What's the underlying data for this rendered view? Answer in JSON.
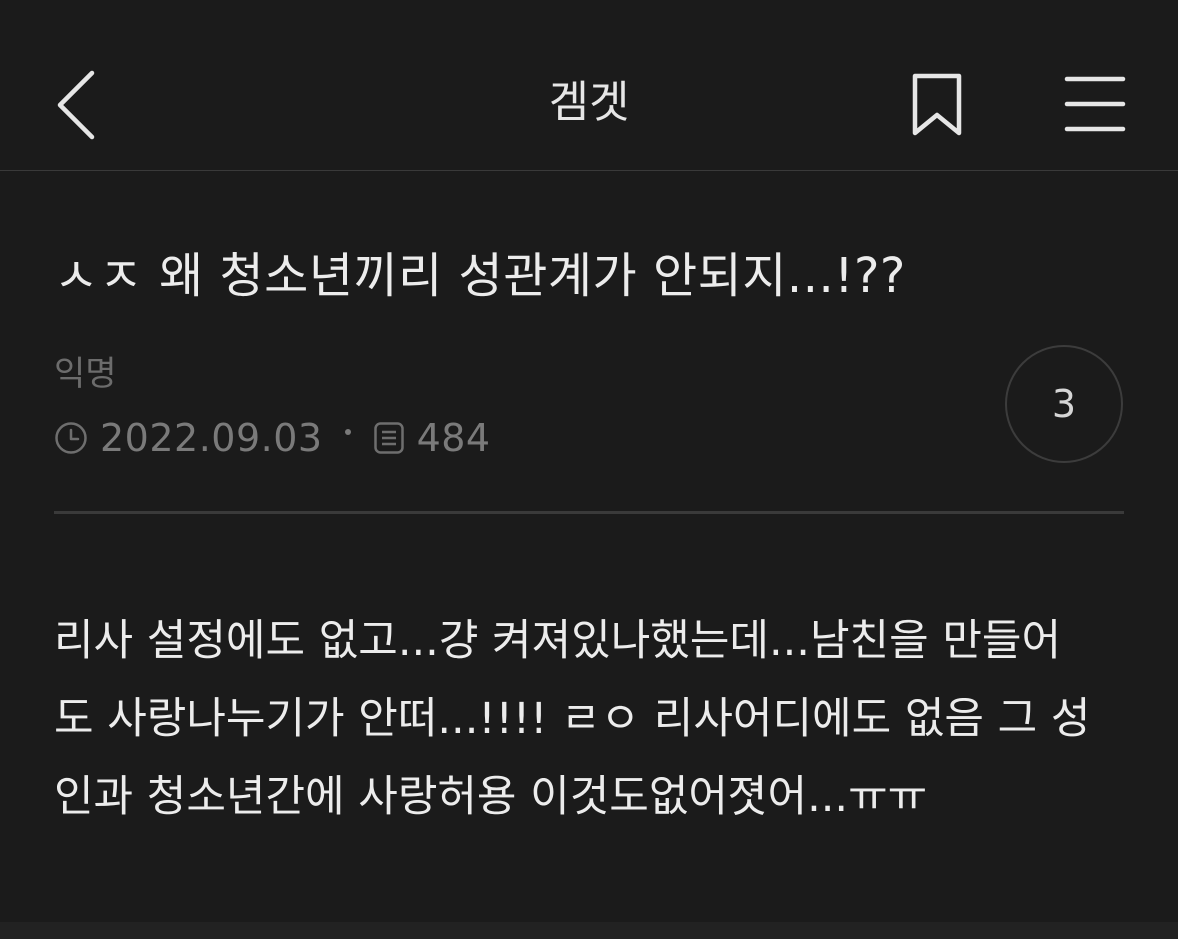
{
  "header": {
    "title": "겜겟",
    "back_icon": "chevron-left-icon",
    "bookmark_icon": "bookmark-icon",
    "menu_icon": "hamburger-menu-icon"
  },
  "post": {
    "title": "ㅅㅈ 왜 청소년끼리 성관계가 안되지...!??",
    "author": "익명",
    "date": "2022.09.03",
    "views": "484",
    "comment_count": "3",
    "body_lines": [
      "리사 설정에도 없고...걍 켜져있나했는데...남친을 만들어",
      "도 사랑나누기가 안떠...!!!! ㄹㅇ 리사어디에도 없음 그 성",
      "인과 청소년간에 사랑허용 이것도없어졋어...ㅠㅠ"
    ]
  },
  "colors": {
    "background": "#1b1b1b",
    "text_primary": "#ececec",
    "text_muted": "#7a7a7a",
    "divider": "#3a3a3a"
  }
}
